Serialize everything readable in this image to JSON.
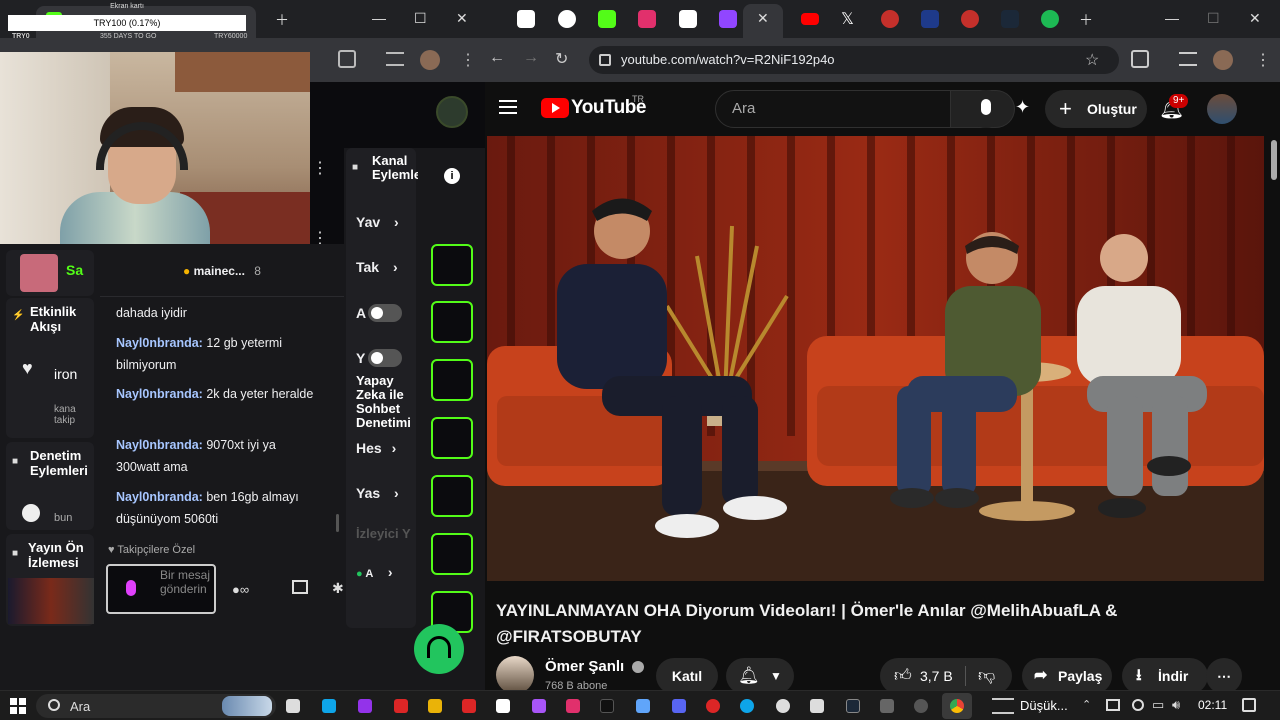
{
  "ticker": {
    "label": "Ekran kartı",
    "value": "TRY100 (0.17%)",
    "left": "TRY0",
    "mid": "355 DAYS TO GO",
    "right": "TRY60000"
  },
  "kick": {
    "pinned_user": "mainec...",
    "pinned_count": "8",
    "left_panel": {
      "activity_title": "Etkinlik Akışı",
      "activity_name": "iron",
      "activity_sub": "kana takip",
      "mod_title": "Denetim Eylemleri",
      "mod_sub": "bun",
      "preview_title": "Yayın Ön İzlemesi",
      "top_user": "Sa"
    },
    "messages": [
      {
        "user": "",
        "text": "dahada iyidir"
      },
      {
        "user": "Nayl0nbranda",
        "text": "12 gb yetermi bilmiyorum"
      },
      {
        "user": "Nayl0nbranda",
        "text": "2k da yeter heralde"
      },
      {
        "user": "Nayl0nbranda",
        "text": "9070xt iyi ya 300watt ama"
      },
      {
        "user": "Nayl0nbranda",
        "text": "ben 16gb almayı düşünüyom 5060ti"
      }
    ],
    "followers_only": "Takipçilere Özel",
    "chat_placeholder": "Bir mesaj gönderin",
    "channel_actions": {
      "title": "Kanal Eylemleri",
      "items": [
        "Yav",
        "Tak",
        "A",
        "Y",
        "Hes",
        "Yas",
        "İzleyici Y",
        "A"
      ],
      "ai_mod": "Yapay Zeka ile Sohbet Denetimi"
    }
  },
  "browser": {
    "url": "youtube.com/watch?v=R2NiF192p4o"
  },
  "youtube": {
    "logo": "YouTube",
    "region": "TR",
    "search_placeholder": "Ara",
    "create_label": "Oluştur",
    "notif_badge": "9+",
    "video_title": "YAYINLANMAYAN OHA Diyorum Videoları! | Ömer'le Anılar @MelihAbuafLA & @FIRATSOBUTAY",
    "channel_name": "Ömer Şanlı",
    "subscribers": "768 B abone",
    "join_label": "Katıl",
    "likes": "3,7 B",
    "share_label": "Paylaş",
    "download_label": "İndir"
  },
  "taskbar": {
    "search_placeholder": "Ara",
    "weather": "Düşük...",
    "time": "02:11"
  },
  "colors": {
    "kick_green": "#53fc18",
    "yt_red": "#ff0000",
    "chat_user": "#a7c6ff"
  }
}
